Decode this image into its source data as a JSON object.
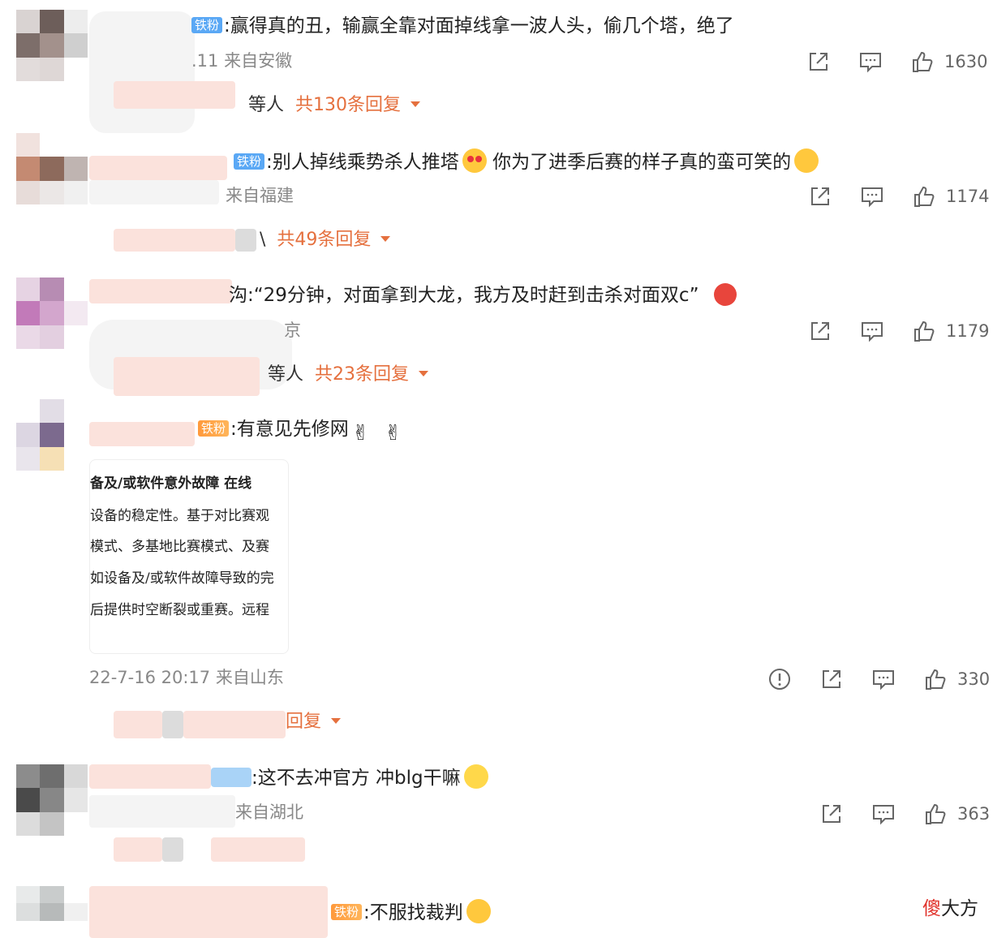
{
  "comments": [
    {
      "badge": "铁粉",
      "text": ":赢得真的丑，输赢全靠对面掉线拿一波人头，偷几个塔，绝了",
      "meta": ".11 来自安徽",
      "likes": "1630",
      "replies_prefix": "等人",
      "replies_count": "共130条回复"
    },
    {
      "badge": "铁粉",
      "text": ":别人掉线乘势杀人推塔",
      "text2": " 你为了进季后赛的样子真的蛮可笑的",
      "meta": "来自福建",
      "likes": "1174",
      "replies_prefix": "\\",
      "replies_count": "共49条回复"
    },
    {
      "badge": "",
      "text": "沟:“29分钟，对面拿到大龙，我方及时赶到击杀对面双c”",
      "meta": "京",
      "likes": "1179",
      "replies_prefix": "等人",
      "replies_count": "共23条回复"
    },
    {
      "badge": "铁粉",
      "text": ":有意见先修网",
      "meta": "22-7-16 20:17 来自山东",
      "likes": "330",
      "replies_prefix": "",
      "replies_count": "回复",
      "image_lines": [
        "备及/或软件意外故障   在线",
        "设备的稳定性。基于对比赛观",
        "模式、多基地比赛模式、及赛",
        "如设备及/或软件故障导致的完",
        "后提供时空断裂或重赛。远程"
      ]
    },
    {
      "badge": "",
      "text": ":这不去冲官方 冲blg干嘛",
      "meta": "来自湖北",
      "likes": "363"
    },
    {
      "badge": "铁粉",
      "text": ":不服找裁判"
    }
  ],
  "icons": {
    "share": "share-icon",
    "comment": "comment-icon",
    "like": "like-icon",
    "report": "report-icon"
  },
  "colors": {
    "accent": "#e5703e",
    "meta": "#888888"
  },
  "watermark": {
    "red": "傻",
    "black": "大方"
  }
}
